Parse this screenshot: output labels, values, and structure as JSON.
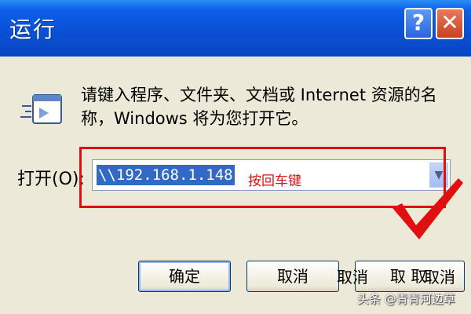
{
  "window": {
    "title": "运行",
    "help_label": "?",
    "close_label": "✕"
  },
  "dialog": {
    "message": "请键入程序、文件夹、文档或 Internet 资源的名称，Windows 将为您打开它。",
    "open_label": "打开(O):",
    "open_value": "\\\\192.168.1.148",
    "dropdown_arrow": "▼"
  },
  "annotation": {
    "text": "按回车键",
    "color": "#e01010"
  },
  "buttons": {
    "ok": "确定",
    "cancel": "取消",
    "browse": "取 取"
  },
  "ghost_text": {
    "left": "取消",
    "right_a": "取",
    "right_b": "消"
  },
  "watermark": "头条 @青青河边草",
  "colors": {
    "titlebar": "#0a4fd4",
    "background": "#ece9d8",
    "selection": "#316ac5"
  }
}
